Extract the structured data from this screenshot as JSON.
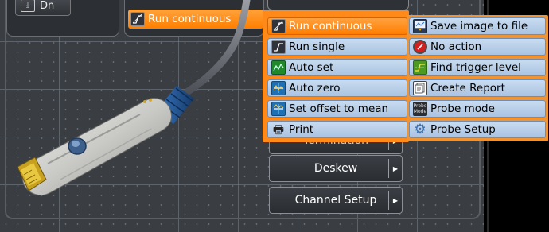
{
  "top_bar": {
    "left_button_label": "Dn",
    "run_continuous_label": "Run continuous"
  },
  "side_buttons": {
    "termination_label": "Termination",
    "deskew_label": "Deskew",
    "channel_setup_label": "Channel Setup"
  },
  "menu_primary": {
    "items": [
      {
        "label": "Run continuous",
        "icon": "run-continuous-icon",
        "selected": true
      },
      {
        "label": "Run single",
        "icon": "run-single-icon",
        "selected": false
      },
      {
        "label": "Auto set",
        "icon": "auto-set-icon",
        "selected": false
      },
      {
        "label": "Auto zero",
        "icon": "auto-zero-icon",
        "selected": false
      },
      {
        "label": "Set offset to mean",
        "icon": "set-offset-icon",
        "selected": false
      },
      {
        "label": "Print",
        "icon": "printer-icon",
        "selected": false
      }
    ]
  },
  "menu_secondary": {
    "items": [
      {
        "label": "Save image to file",
        "icon": "save-image-icon"
      },
      {
        "label": "No action",
        "icon": "no-action-icon"
      },
      {
        "label": "Find trigger level",
        "icon": "trigger-level-icon"
      },
      {
        "label": "Create Report",
        "icon": "report-icon"
      },
      {
        "label": "Probe mode",
        "icon": "probe-mode-icon",
        "icon_text_top": "Probe",
        "icon_text_bottom": "Mode"
      },
      {
        "label": "Probe Setup",
        "icon": "gear-icon"
      }
    ]
  },
  "colors": {
    "menu_orange": "#ff8a1a",
    "item_blue": "#b9d0ea",
    "selected_orange": "#ff8c10",
    "panel_bg": "#3a3d42"
  }
}
